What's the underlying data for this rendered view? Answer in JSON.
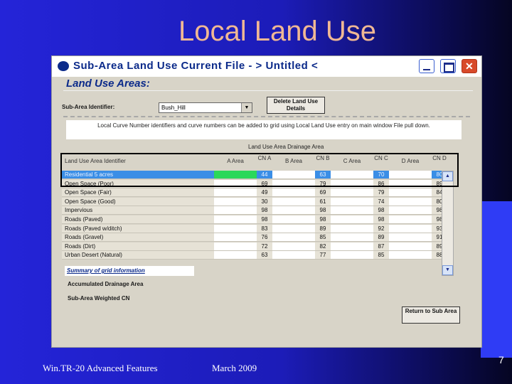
{
  "slide": {
    "title": "Local Land Use",
    "footer_left": "Win.TR-20 Advanced Features",
    "footer_center": "March 2009",
    "page_number": "7"
  },
  "window": {
    "title": "Sub-Area Land Use    Current File - > Untitled <",
    "heading": "Land Use Areas:",
    "sub_area_label": "Sub-Area Identifier:",
    "sub_area_value": "Bush_Hill",
    "delete_button": "Delete Land Use Details",
    "note": "Local Curve Number identifiers and curve numbers can be added to grid using Local Land Use entry on main window File pull down.",
    "section_heading": "Land Use Area Drainage Area",
    "columns": [
      "Land Use Area Identifier",
      "A Area",
      "CN A",
      "B Area",
      "CN B",
      "C Area",
      "CN C",
      "D Area",
      "CN D"
    ],
    "rows": [
      [
        "Residential 5 acres",
        "",
        "44",
        "",
        "63",
        "",
        "70",
        "",
        "80"
      ],
      [
        "Open Space (Poor)",
        "",
        "69",
        "",
        "79",
        "",
        "86",
        "",
        "89"
      ],
      [
        "Open Space (Fair)",
        "",
        "49",
        "",
        "69",
        "",
        "79",
        "",
        "84"
      ],
      [
        "Open Space (Good)",
        "",
        "30",
        "",
        "61",
        "",
        "74",
        "",
        "80"
      ],
      [
        "Impervious",
        "",
        "98",
        "",
        "98",
        "",
        "98",
        "",
        "98"
      ],
      [
        "Roads (Paved)",
        "",
        "98",
        "",
        "98",
        "",
        "98",
        "",
        "98"
      ],
      [
        "Roads (Paved w/ditch)",
        "",
        "83",
        "",
        "89",
        "",
        "92",
        "",
        "93"
      ],
      [
        "Roads (Gravel)",
        "",
        "76",
        "",
        "85",
        "",
        "89",
        "",
        "91"
      ],
      [
        "Roads (Dirt)",
        "",
        "72",
        "",
        "82",
        "",
        "87",
        "",
        "89"
      ],
      [
        "Urban Desert (Natural)",
        "",
        "63",
        "",
        "77",
        "",
        "85",
        "",
        "88"
      ]
    ],
    "summary_label": "Summary of grid information",
    "accumulated_label": "Accumulated Drainage Area",
    "weighted_label": "Sub-Area Weighted CN",
    "return_button": "Return to Sub Area"
  },
  "colors": {
    "selected_row": "#3a8ee6",
    "selected_cell": "#2bd85a",
    "title_text": "#0b2a8a",
    "slide_title": "#f0b894"
  }
}
